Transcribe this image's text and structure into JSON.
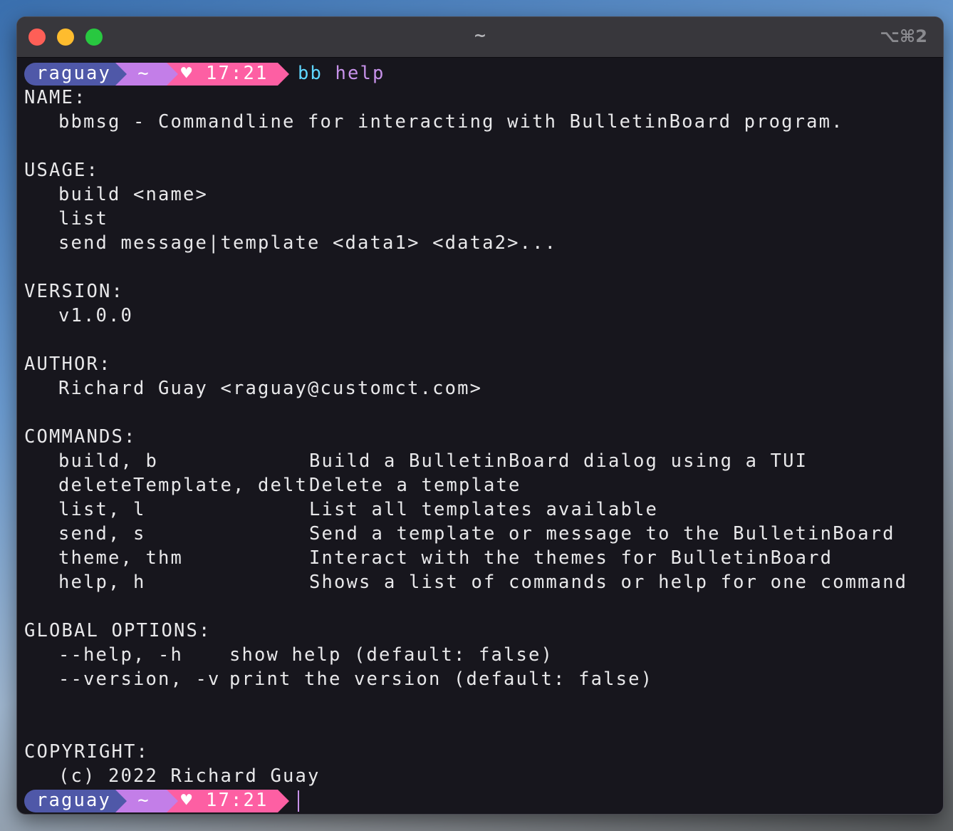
{
  "window": {
    "title": "~",
    "shortcut": "⌥⌘2"
  },
  "prompt": {
    "user": "raguay",
    "dir": "~",
    "time": "♥ 17:21"
  },
  "command": {
    "program": "bb",
    "arg": "help"
  },
  "name": {
    "header": "NAME:",
    "text": "bbmsg - Commandline for interacting with BulletinBoard program."
  },
  "usage": {
    "header": "USAGE:",
    "lines": [
      "build <name>",
      "list",
      "send message|template <data1> <data2>..."
    ]
  },
  "version": {
    "header": "VERSION:",
    "text": "v1.0.0"
  },
  "author": {
    "header": "AUTHOR:",
    "text": "Richard Guay <raguay@customct.com>"
  },
  "commands": {
    "header": "COMMANDS:",
    "items": [
      {
        "name": "build, b",
        "desc": "Build a BulletinBoard dialog using a TUI"
      },
      {
        "name": "deleteTemplate, delt",
        "desc": "Delete a template"
      },
      {
        "name": "list, l",
        "desc": "List all templates available"
      },
      {
        "name": "send, s",
        "desc": "Send a template or message to the BulletinBoard"
      },
      {
        "name": "theme, thm",
        "desc": "Interact with the themes for BulletinBoard"
      },
      {
        "name": "help, h",
        "desc": "Shows a list of commands or help for one command"
      }
    ]
  },
  "options": {
    "header": "GLOBAL OPTIONS:",
    "items": [
      {
        "flag": "--help, -h",
        "desc": "show help (default: false)"
      },
      {
        "flag": "--version, -v",
        "desc": "print the version (default: false)"
      }
    ]
  },
  "copyright": {
    "header": "COPYRIGHT:",
    "text": "(c) 2022 Richard Guay"
  }
}
